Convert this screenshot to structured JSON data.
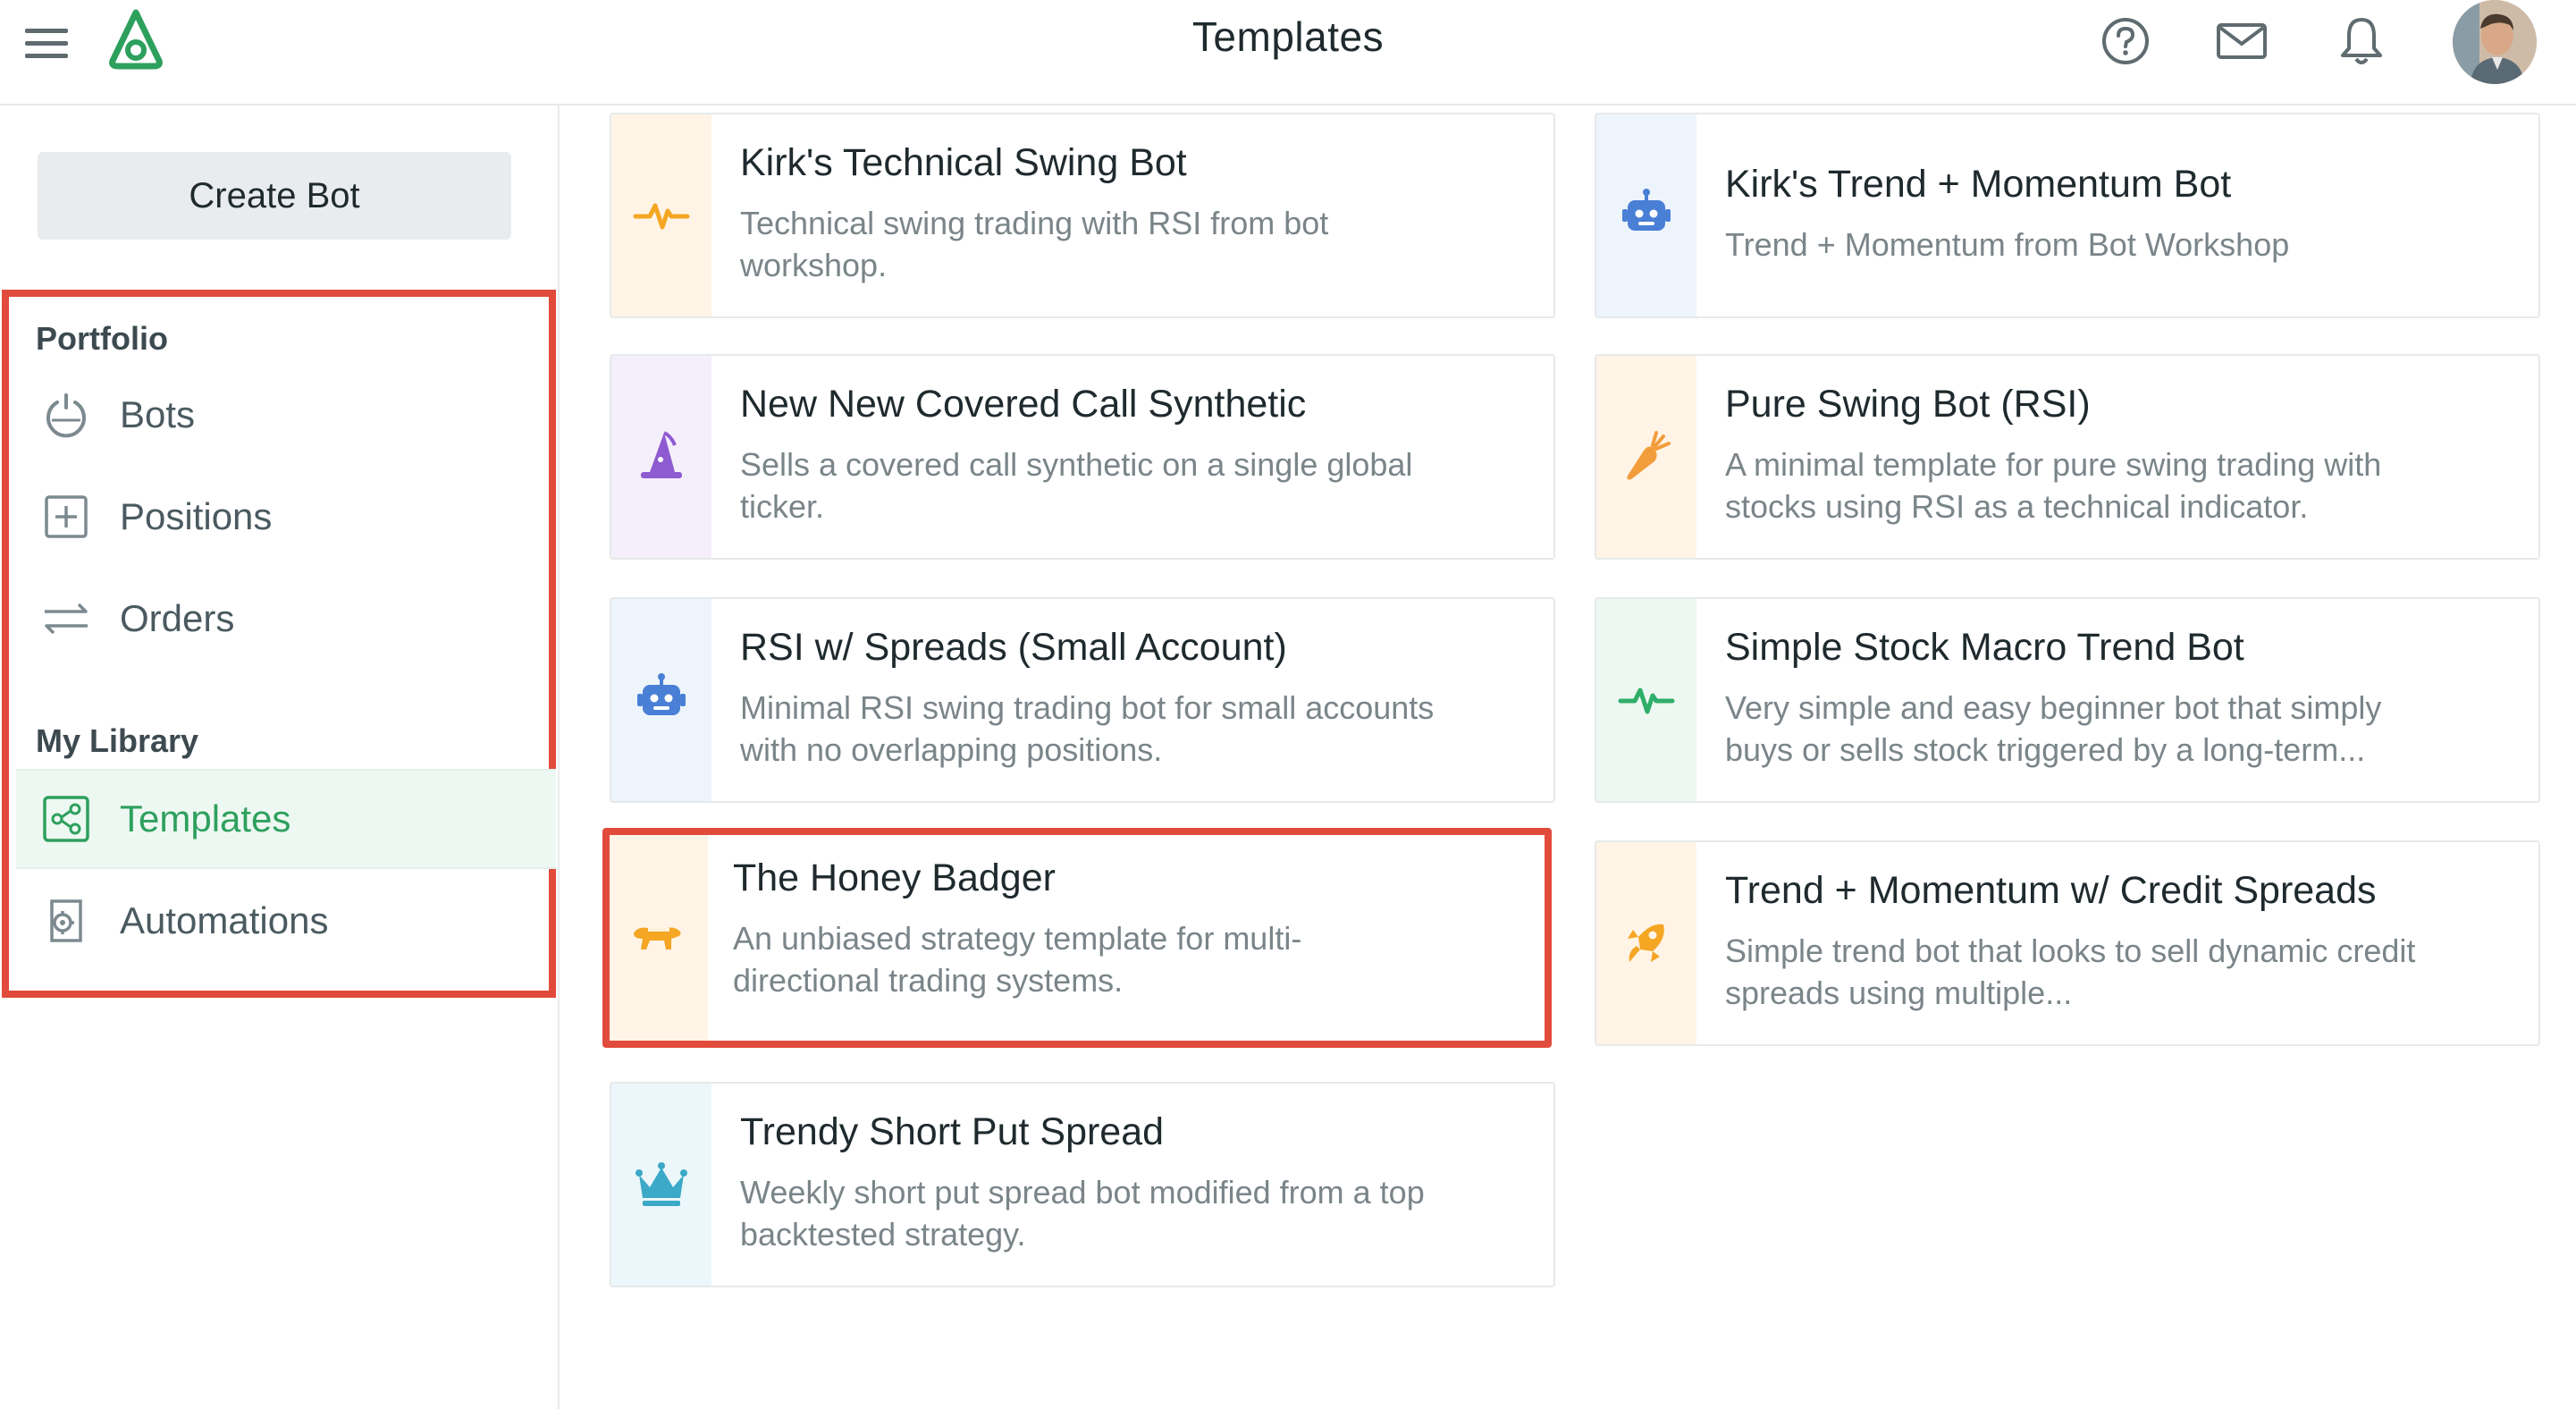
{
  "header": {
    "title": "Templates",
    "icons": [
      "menu-icon",
      "app-logo",
      "help-icon",
      "mail-icon",
      "bell-icon",
      "avatar"
    ]
  },
  "sidebar": {
    "create_button": "Create Bot",
    "portfolio_label": "Portfolio",
    "portfolio_items": [
      {
        "label": "Bots",
        "icon": "power-icon"
      },
      {
        "label": "Positions",
        "icon": "plus-square-icon"
      },
      {
        "label": "Orders",
        "icon": "swap-arrows-icon"
      }
    ],
    "library_label": "My Library",
    "library_items": [
      {
        "label": "Templates",
        "icon": "share-nodes-icon",
        "active": true
      },
      {
        "label": "Automations",
        "icon": "gear-doc-icon"
      }
    ]
  },
  "templates": [
    {
      "title": "Kirk's Technical Swing Bot",
      "description": "Technical swing trading with RSI from bot workshop.",
      "icon": "pulse-icon",
      "color": "#f5a623"
    },
    {
      "title": "Kirk's Trend + Momentum Bot",
      "description": "Trend + Momentum from Bot Workshop",
      "icon": "robot-icon",
      "color": "#4a7fd6"
    },
    {
      "title": "New New Covered Call Synthetic",
      "description": "Sells a covered call synthetic on a single global ticker.",
      "icon": "wizard-hat-icon",
      "color": "#8e5bd0"
    },
    {
      "title": "Pure Swing Bot (RSI)",
      "description": "A minimal template for pure swing trading with stocks using RSI as a technical indicator.",
      "icon": "carrot-icon",
      "color": "#f39c3c"
    },
    {
      "title": "RSI w/ Spreads (Small Account)",
      "description": "Minimal RSI swing trading bot for small accounts with no overlapping positions.",
      "icon": "robot-icon",
      "color": "#4a7fd6"
    },
    {
      "title": "Simple Stock Macro Trend Bot",
      "description": "Very simple and easy beginner bot that simply buys or sells stock triggered by a long-term...",
      "icon": "pulse-icon",
      "color": "#2fae6a"
    },
    {
      "title": "The Honey Badger",
      "description": "An unbiased strategy template for multi-directional trading systems.",
      "icon": "badger-icon",
      "color": "#f5a623"
    },
    {
      "title": "Trend + Momentum w/ Credit Spreads",
      "description": "Simple trend bot that looks to sell dynamic credit spreads using multiple...",
      "icon": "rocket-icon",
      "color": "#f5a623"
    },
    {
      "title": "Trendy Short Put Spread",
      "description": "Weekly short put spread bot modified from a top backtested strategy.",
      "icon": "crown-icon",
      "color": "#3ba9c7"
    }
  ]
}
